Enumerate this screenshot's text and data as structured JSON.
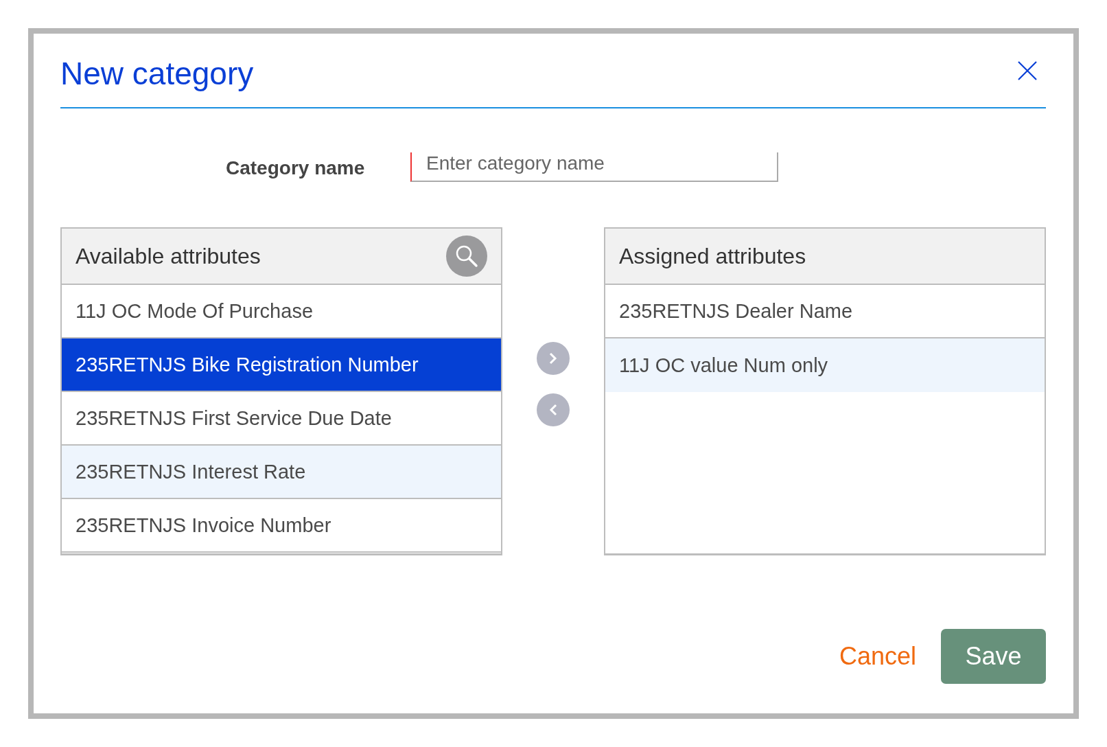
{
  "dialog": {
    "title": "New category"
  },
  "category_name": {
    "label": "Category name",
    "placeholder": "Enter category name",
    "required": true
  },
  "available": {
    "title": "Available attributes",
    "items": [
      {
        "label": "11J OC Mode Of Purchase",
        "selected": false,
        "highlighted": false
      },
      {
        "label": "235RETNJS Bike Registration Number",
        "selected": true,
        "highlighted": false
      },
      {
        "label": "235RETNJS First Service Due Date",
        "selected": false,
        "highlighted": false
      },
      {
        "label": "235RETNJS Interest Rate",
        "selected": false,
        "highlighted": true
      },
      {
        "label": "235RETNJS Invoice Number",
        "selected": false,
        "highlighted": false
      }
    ]
  },
  "assigned": {
    "title": "Assigned attributes",
    "items": [
      {
        "label": "235RETNJS Dealer Name",
        "selected": false,
        "highlighted": false
      },
      {
        "label": "11J OC value Num only",
        "selected": false,
        "highlighted": true
      }
    ]
  },
  "buttons": {
    "cancel": "Cancel",
    "save": "Save"
  }
}
